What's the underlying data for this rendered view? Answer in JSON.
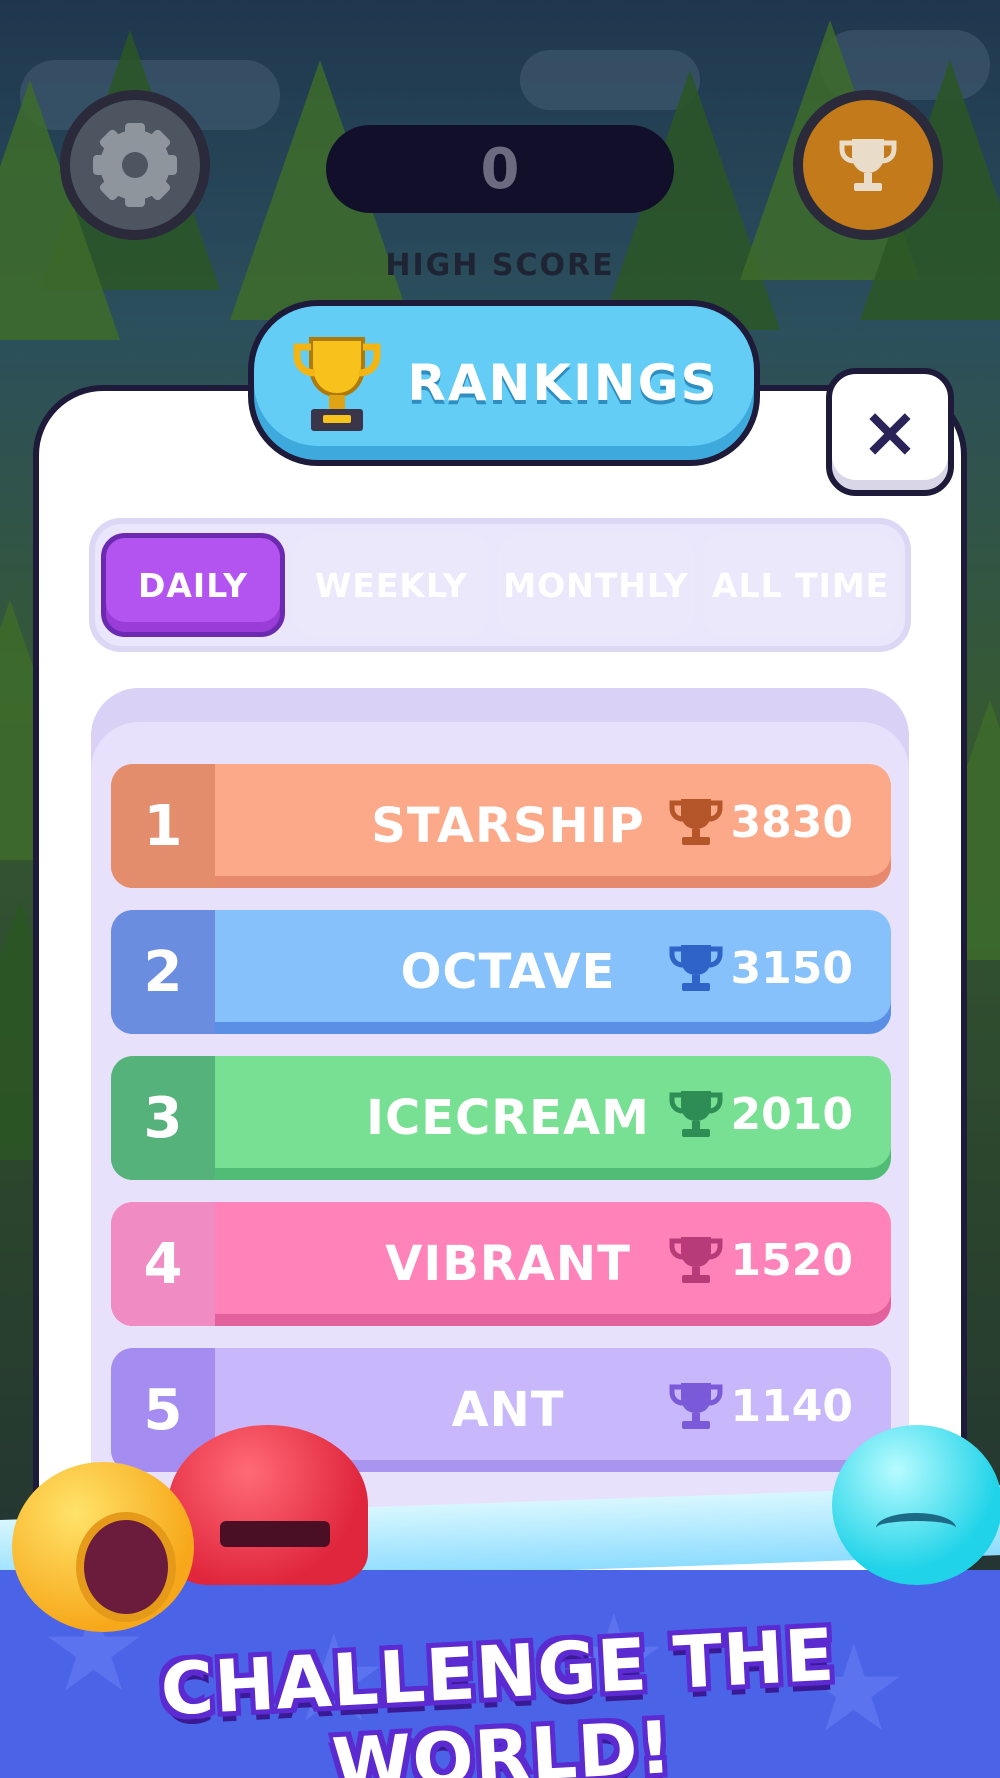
{
  "hud": {
    "score": "0",
    "high_score_label": "HIGH SCORE"
  },
  "dialog": {
    "title": "RANKINGS",
    "close_label": "×",
    "tabs": [
      {
        "label": "DAILY",
        "active": true
      },
      {
        "label": "WEEKLY",
        "active": false
      },
      {
        "label": "MONTHLY",
        "active": false
      },
      {
        "label": "ALL TIME",
        "active": false
      }
    ],
    "rows": [
      {
        "rank": "1",
        "name": "STARSHIP",
        "score": "3830",
        "color": "#fca98a",
        "dark": "#e38d6c",
        "shade": "#e7896c",
        "cup": "#b4552a"
      },
      {
        "rank": "2",
        "name": "OCTAVE",
        "score": "3150",
        "color": "#86c1fb",
        "dark": "#6a8de0",
        "shade": "#5b8fe5",
        "cup": "#2f63c8"
      },
      {
        "rank": "3",
        "name": "ICECREAM",
        "score": "2010",
        "color": "#78e093",
        "dark": "#56b27b",
        "shade": "#4fbd75",
        "cup": "#2e8d55"
      },
      {
        "rank": "4",
        "name": "VIBRANT",
        "score": "1520",
        "color": "#ff82b8",
        "dark": "#f08bc4",
        "shade": "#e3629e",
        "cup": "#b63b78"
      },
      {
        "rank": "5",
        "name": "ANT",
        "score": "1140",
        "color": "#c8b8fb",
        "dark": "#a58cf0",
        "shade": "#a994ef",
        "cup": "#7a5ad8"
      }
    ]
  },
  "footer": {
    "tagline": "CHALLENGE THE WORLD!"
  },
  "icons": {
    "settings": "gear-icon",
    "leaderboard": "trophy-icon",
    "close": "close-icon",
    "score_cup": "trophy-icon"
  }
}
